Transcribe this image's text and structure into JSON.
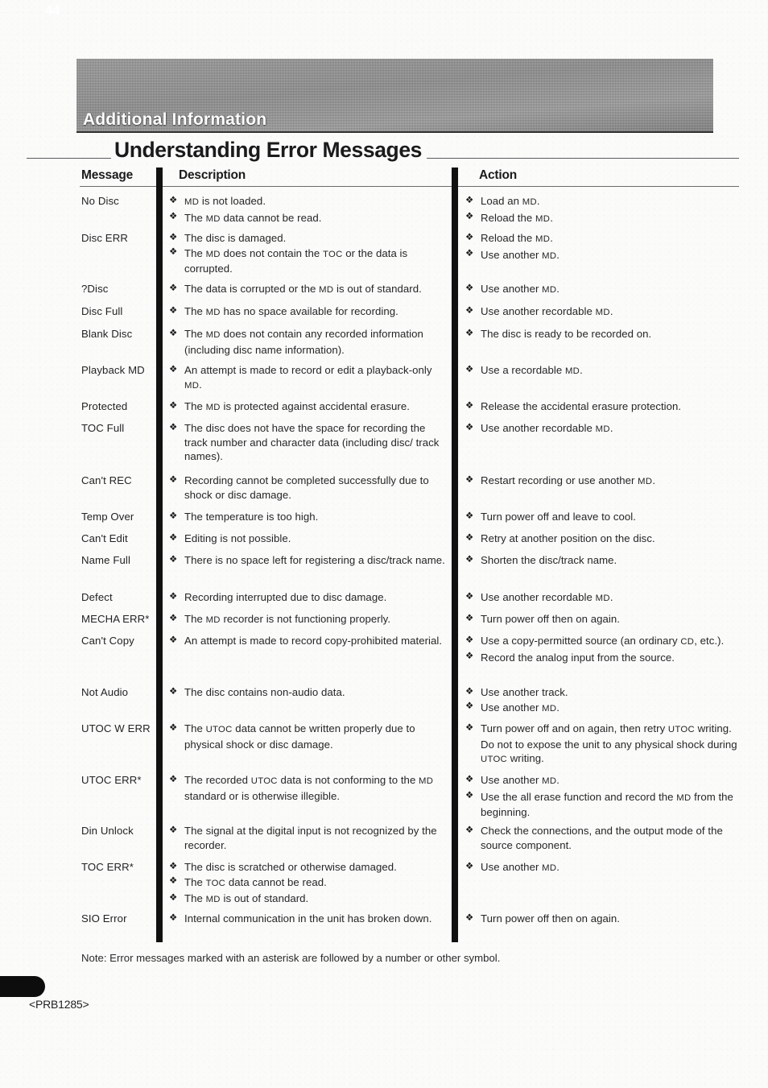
{
  "banner": {
    "section_label": "Additional Information"
  },
  "page_title": "Understanding Error Messages",
  "table": {
    "headers": {
      "message": "Message",
      "description": "Description",
      "action": "Action"
    },
    "rows": [
      {
        "message": "No Disc",
        "description": [
          "MD is not loaded.",
          "The MD data cannot be read."
        ],
        "action": [
          "Load an MD.",
          "Reload the MD."
        ]
      },
      {
        "message": "Disc ERR",
        "description": [
          "The disc is damaged.",
          "The MD does not contain the TOC or the data is corrupted."
        ],
        "action": [
          "Reload the MD.",
          "Use another MD."
        ]
      },
      {
        "message": "?Disc",
        "description": [
          "The data is corrupted or the MD is out of standard."
        ],
        "action": [
          "Use another MD."
        ]
      },
      {
        "message": "Disc Full",
        "description": [
          "The MD has no space available for recording."
        ],
        "action": [
          "Use another recordable MD."
        ]
      },
      {
        "message": "Blank Disc",
        "description": [
          "The MD does not contain any recorded information (including disc name information)."
        ],
        "action": [
          "The disc is ready to be recorded on."
        ]
      },
      {
        "message": "Playback MD",
        "description": [
          "An attempt is made to record or edit a playback-only MD."
        ],
        "action": [
          "Use a recordable MD."
        ]
      },
      {
        "message": "Protected",
        "description": [
          "The MD is protected against accidental erasure."
        ],
        "action": [
          "Release the accidental erasure protection."
        ]
      },
      {
        "message": "TOC Full",
        "description": [
          "The disc does not have the space for recording the track number and character data (including disc/ track names)."
        ],
        "action": [
          "Use another recordable MD."
        ]
      },
      {
        "message": "Can't REC",
        "description": [
          "Recording cannot be completed successfully due to shock or disc damage."
        ],
        "action": [
          "Restart recording or use another MD."
        ]
      },
      {
        "message": "Temp Over",
        "description": [
          "The temperature is too high."
        ],
        "action": [
          "Turn power off and leave to cool."
        ]
      },
      {
        "message": "Can't Edit",
        "description": [
          "Editing is not possible."
        ],
        "action": [
          "Retry at another position on the disc."
        ]
      },
      {
        "message": "Name Full",
        "description": [
          "There is no space left for registering a disc/track name."
        ],
        "action": [
          "Shorten the disc/track name."
        ]
      },
      {
        "message": "Defect",
        "description": [
          "Recording interrupted due to disc damage."
        ],
        "action": [
          "Use another recordable MD."
        ]
      },
      {
        "message": "MECHA ERR*",
        "description": [
          "The MD recorder is not functioning properly."
        ],
        "action": [
          "Turn power off then on again."
        ]
      },
      {
        "message": "Can't Copy",
        "description": [
          "An attempt is made to record copy-prohibited material."
        ],
        "action": [
          "Use a copy-permitted source (an ordinary CD, etc.).",
          "Record the analog input from the source."
        ]
      },
      {
        "message": "Not Audio",
        "description": [
          "The disc contains non-audio data."
        ],
        "action": [
          "Use another track.",
          "Use another MD."
        ]
      },
      {
        "message": "UTOC W ERR",
        "description": [
          "The UTOC data cannot be written properly due to physical shock or disc damage."
        ],
        "action": [
          "Turn power off and on again, then retry UTOC writing. Do not to expose the unit to any physical shock during UTOC writing."
        ]
      },
      {
        "message": "UTOC ERR*",
        "description": [
          "The recorded UTOC data is not conforming to the MD standard or is otherwise illegible."
        ],
        "action": [
          "Use another MD.",
          "Use the all erase function and record the MD from the beginning."
        ]
      },
      {
        "message": "Din Unlock",
        "description": [
          "The signal at the digital input is not recognized by the recorder."
        ],
        "action": [
          "Check the connections, and the output mode of the source component."
        ]
      },
      {
        "message": "TOC ERR*",
        "description": [
          "The disc is scratched or otherwise damaged.",
          "The TOC data cannot be read.",
          "The MD is out of standard."
        ],
        "action": [
          "Use another MD."
        ]
      },
      {
        "message": "SIO Error",
        "description": [
          "Internal communication in the unit has broken down."
        ],
        "action": [
          "Turn power off then on again."
        ]
      }
    ]
  },
  "note": "Note: Error messages marked with an asterisk are followed by a number or other symbol.",
  "footer": {
    "page_number": "44",
    "part_code": "<PRB1285>"
  },
  "icons": {
    "bullet": "bullet-diamond-icon"
  }
}
